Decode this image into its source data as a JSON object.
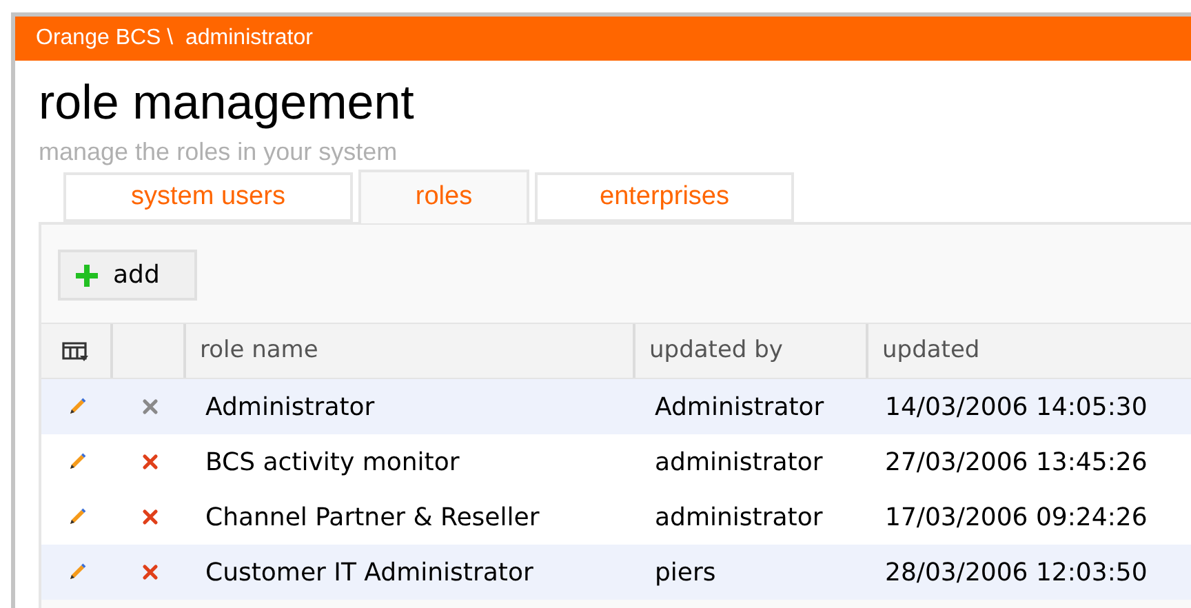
{
  "header": {
    "breadcrumb": "Orange BCS \\  administrator"
  },
  "page": {
    "title": "role management",
    "subtitle": "manage the roles in your system"
  },
  "tabs": [
    {
      "label": "system users",
      "selected": false
    },
    {
      "label": "roles",
      "selected": true
    },
    {
      "label": "enterprises",
      "selected": false
    }
  ],
  "toolbar": {
    "add_button": "add"
  },
  "table": {
    "columns": [
      "role name",
      "updated by",
      "updated"
    ],
    "rows": [
      {
        "role_name": "Administrator",
        "updated_by": "Administrator",
        "updated": "14/03/2006 14:05:30",
        "shaded": true,
        "delete_disabled": true
      },
      {
        "role_name": "BCS activity monitor",
        "updated_by": "administrator",
        "updated": "27/03/2006 13:45:26",
        "shaded": false,
        "delete_disabled": false
      },
      {
        "role_name": "Channel Partner & Reseller",
        "updated_by": "administrator",
        "updated": "17/03/2006 09:24:26",
        "shaded": false,
        "delete_disabled": false
      },
      {
        "role_name": "Customer IT Administrator",
        "updated_by": "piers",
        "updated": "28/03/2006 12:03:50",
        "shaded": true,
        "delete_disabled": false
      }
    ]
  }
}
